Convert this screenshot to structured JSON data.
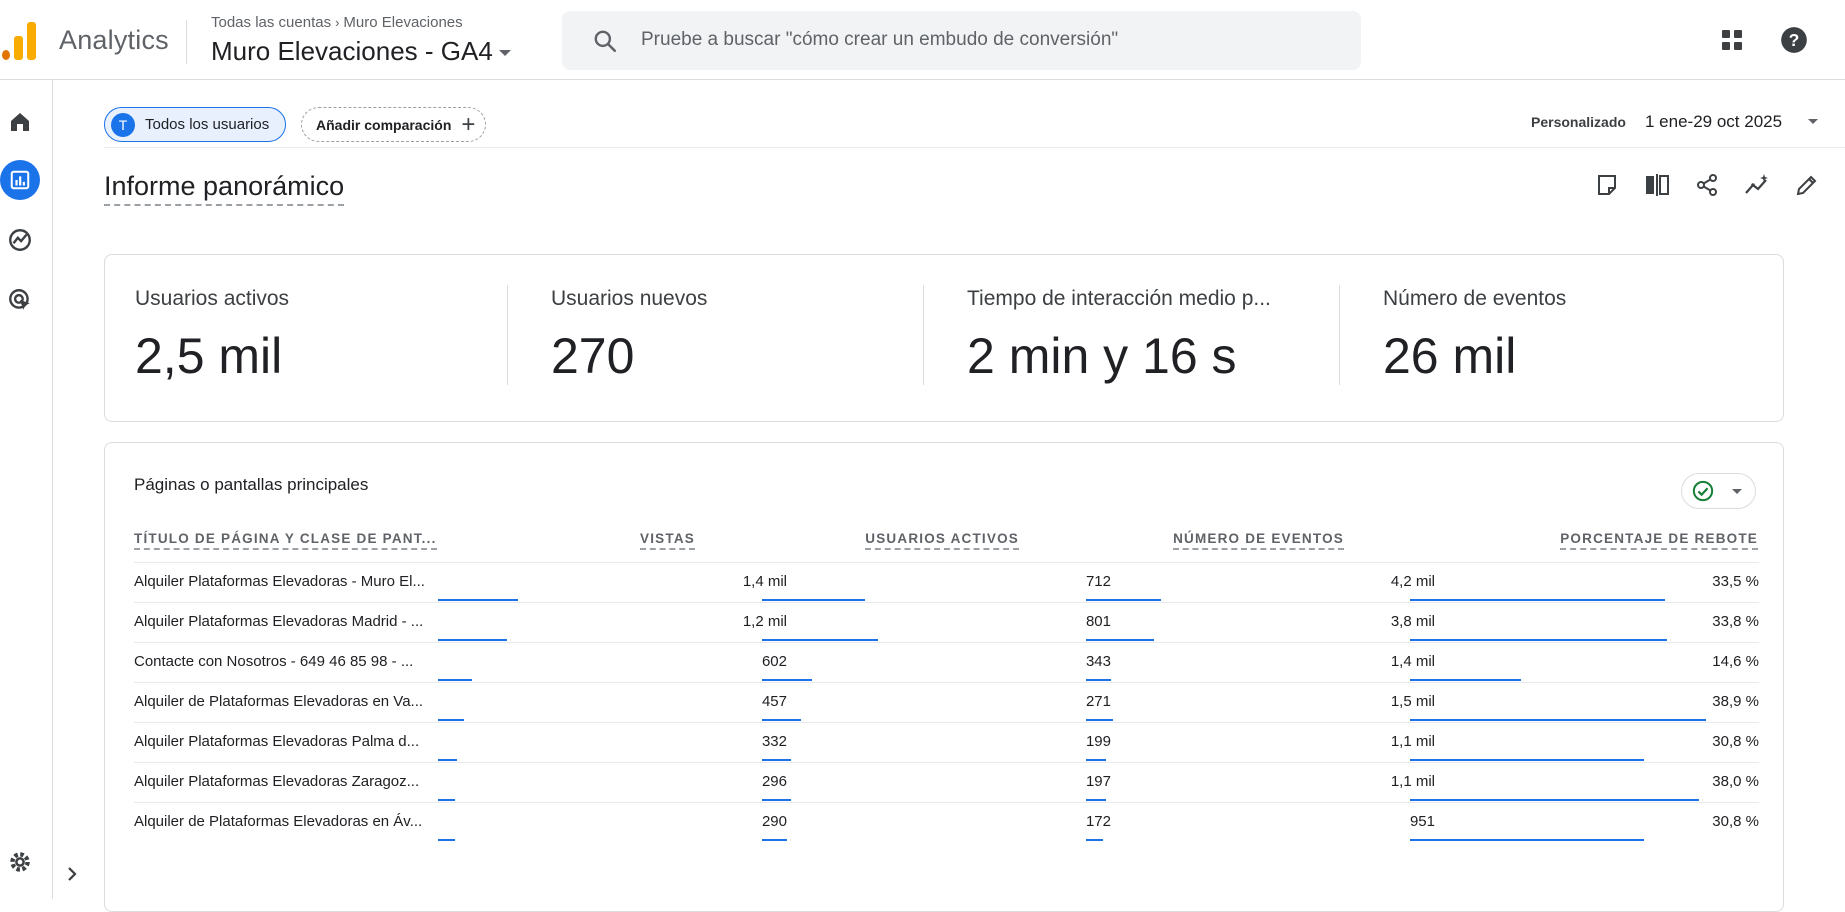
{
  "app": {
    "name": "Analytics",
    "breadcrumb": [
      "Todas las cuentas",
      "Muro Elevaciones"
    ],
    "property": "Muro Elevaciones - GA4"
  },
  "search": {
    "placeholder": "Pruebe a buscar \"cómo crear un embudo de conversión\""
  },
  "header": {
    "segment_initial": "T",
    "segment_label": "Todos los usuarios",
    "compare_label": "Añadir comparación",
    "date_label": "Personalizado",
    "date_range": "1 ene-29 oct 2025",
    "title": "Informe panorámico"
  },
  "kpis": [
    {
      "label": "Usuarios activos",
      "value": "2,5 mil"
    },
    {
      "label": "Usuarios nuevos",
      "value": "270"
    },
    {
      "label": "Tiempo de interacción medio p...",
      "value": "2 min y 16 s"
    },
    {
      "label": "Número de eventos",
      "value": "26 mil"
    }
  ],
  "table": {
    "title": "Páginas o pantallas principales",
    "columns": [
      "TÍTULO DE PÁGINA Y CLASE DE PANT...",
      "VISTAS",
      "USUARIOS ACTIVOS",
      "NÚMERO DE EVENTOS",
      "PORCENTAJE DE REBOTE"
    ],
    "rows": [
      {
        "name": "Alquiler Plataformas Elevadoras - Muro El...",
        "views": "1,4 mil",
        "users": "712",
        "events": "4,2 mil",
        "bounce": "33,5 %",
        "views_frac": 1.0,
        "users_frac": 0.889,
        "events_frac": 0.75,
        "bounce_frac": 0.861
      },
      {
        "name": "Alquiler Plataformas Elevadoras Madrid - ...",
        "views": "1,2 mil",
        "users": "801",
        "events": "3,8 mil",
        "bounce": "33,8 %",
        "views_frac": 0.857,
        "users_frac": 1.0,
        "events_frac": 0.679,
        "bounce_frac": 0.869
      },
      {
        "name": "Contacte con Nosotros - 649 46 85 98 - ...",
        "views": "602",
        "users": "343",
        "events": "1,4 mil",
        "bounce": "14,6 %",
        "views_frac": 0.43,
        "users_frac": 0.428,
        "events_frac": 0.25,
        "bounce_frac": 0.375
      },
      {
        "name": "Alquiler de Plataformas Elevadoras en Va...",
        "views": "457",
        "users": "271",
        "events": "1,5 mil",
        "bounce": "38,9 %",
        "views_frac": 0.326,
        "users_frac": 0.338,
        "events_frac": 0.268,
        "bounce_frac": 1.0
      },
      {
        "name": "Alquiler Plataformas Elevadoras Palma d...",
        "views": "332",
        "users": "199",
        "events": "1,1 mil",
        "bounce": "30,8 %",
        "views_frac": 0.237,
        "users_frac": 0.248,
        "events_frac": 0.196,
        "bounce_frac": 0.792
      },
      {
        "name": "Alquiler Plataformas Elevadoras Zaragoz...",
        "views": "296",
        "users": "197",
        "events": "1,1 mil",
        "bounce": "38,0 %",
        "views_frac": 0.211,
        "users_frac": 0.246,
        "events_frac": 0.196,
        "bounce_frac": 0.977
      },
      {
        "name": "Alquiler de Plataformas Elevadoras en Áv...",
        "views": "290",
        "users": "172",
        "events": "951",
        "bounce": "30,8 %",
        "views_frac": 0.207,
        "users_frac": 0.215,
        "events_frac": 0.17,
        "bounce_frac": 0.792
      }
    ]
  },
  "colors": {
    "accent": "#1a73e8",
    "logo_orange": "#f9ab00",
    "logo_dark_orange": "#e37400",
    "success": "#188038"
  },
  "icons": [
    "search-icon",
    "apps-icon",
    "help-icon",
    "home-icon",
    "reports-icon",
    "explore-icon",
    "advertising-icon",
    "settings-icon",
    "chevron-right-icon",
    "notes-icon",
    "compare-icon",
    "share-icon",
    "insights-icon",
    "edit-icon",
    "check-circle-icon"
  ]
}
